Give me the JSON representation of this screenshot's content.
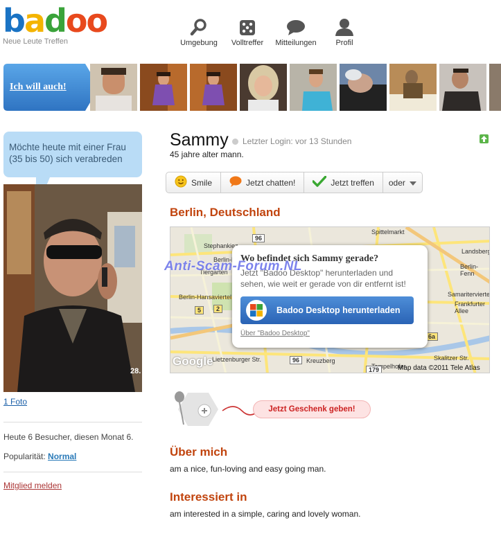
{
  "brand": {
    "logo_letters": [
      "b",
      "a",
      "d",
      "o",
      "o"
    ],
    "logo_colors": [
      "#1a73c4",
      "#f4b400",
      "#3aa33a",
      "#e8491d",
      "#e8491d"
    ],
    "tagline": "Neue Leute Treffen"
  },
  "nav": {
    "items": [
      {
        "label": "Umgebung",
        "icon": "search-icon"
      },
      {
        "label": "Volltreffer",
        "icon": "dice-icon"
      },
      {
        "label": "Mitteilungen",
        "icon": "chat-bubble-icon"
      },
      {
        "label": "Profil",
        "icon": "person-icon"
      }
    ]
  },
  "strip": {
    "cta_label": "Ich will auch!"
  },
  "profile": {
    "status_message": "Möchte heute mit einer Frau (35 bis 50) sich verabreden",
    "photo_caption": "28.",
    "photo_count_link": "1 Foto",
    "visitors": "Heute 6 Besucher, diesen Monat 6.",
    "popularity_label": "Popularität:",
    "popularity_value": "Normal",
    "report_link": "Mitglied melden",
    "name": "Sammy",
    "last_login": "Letzter Login: vor 13 Stunden",
    "age_line": "45 jahre alter mann.",
    "location": "Berlin, Deutschland"
  },
  "actions": {
    "smile": "Smile",
    "chat": "Jetzt chatten!",
    "meet": "Jetzt treffen",
    "more": "oder"
  },
  "map": {
    "popup_title": "Wo befindet sich Sammy gerade?",
    "popup_text": "Jetzt \"Badoo Desktop\" herunterladen und sehen, wie weit er gerade von dir entfernt ist!",
    "download_button": "Badoo Desktop herunterladen",
    "about_link": "Über \"Badoo Desktop\"",
    "credit": "Map data ©2011 Tele Atlas",
    "google_logo": "Google",
    "watermark": "Anti-Scam-Forum.NL",
    "place_labels": [
      "Stephankiez",
      "Berlin-Moabit",
      "Tiergarten",
      "Berlin-Hansaviertel",
      "Kreuzberg",
      "Berlin-Fenn",
      "Landsberger",
      "Samariterviertel",
      "Frankfurter Allee",
      "Skalitzer Str.",
      "Lietzenburger Str.",
      "Spittelmarkt",
      "Tempelhofer"
    ],
    "road_badges": [
      "96",
      "5",
      "2",
      "96",
      "179",
      "6a"
    ]
  },
  "gift": {
    "button": "Jetzt Geschenk geben!"
  },
  "about": {
    "title": "Über mich",
    "text": "am a nice, fun-loving and easy going man."
  },
  "interests": {
    "title": "Interessiert in",
    "text": "am interested in a simple, caring and lovely woman."
  }
}
